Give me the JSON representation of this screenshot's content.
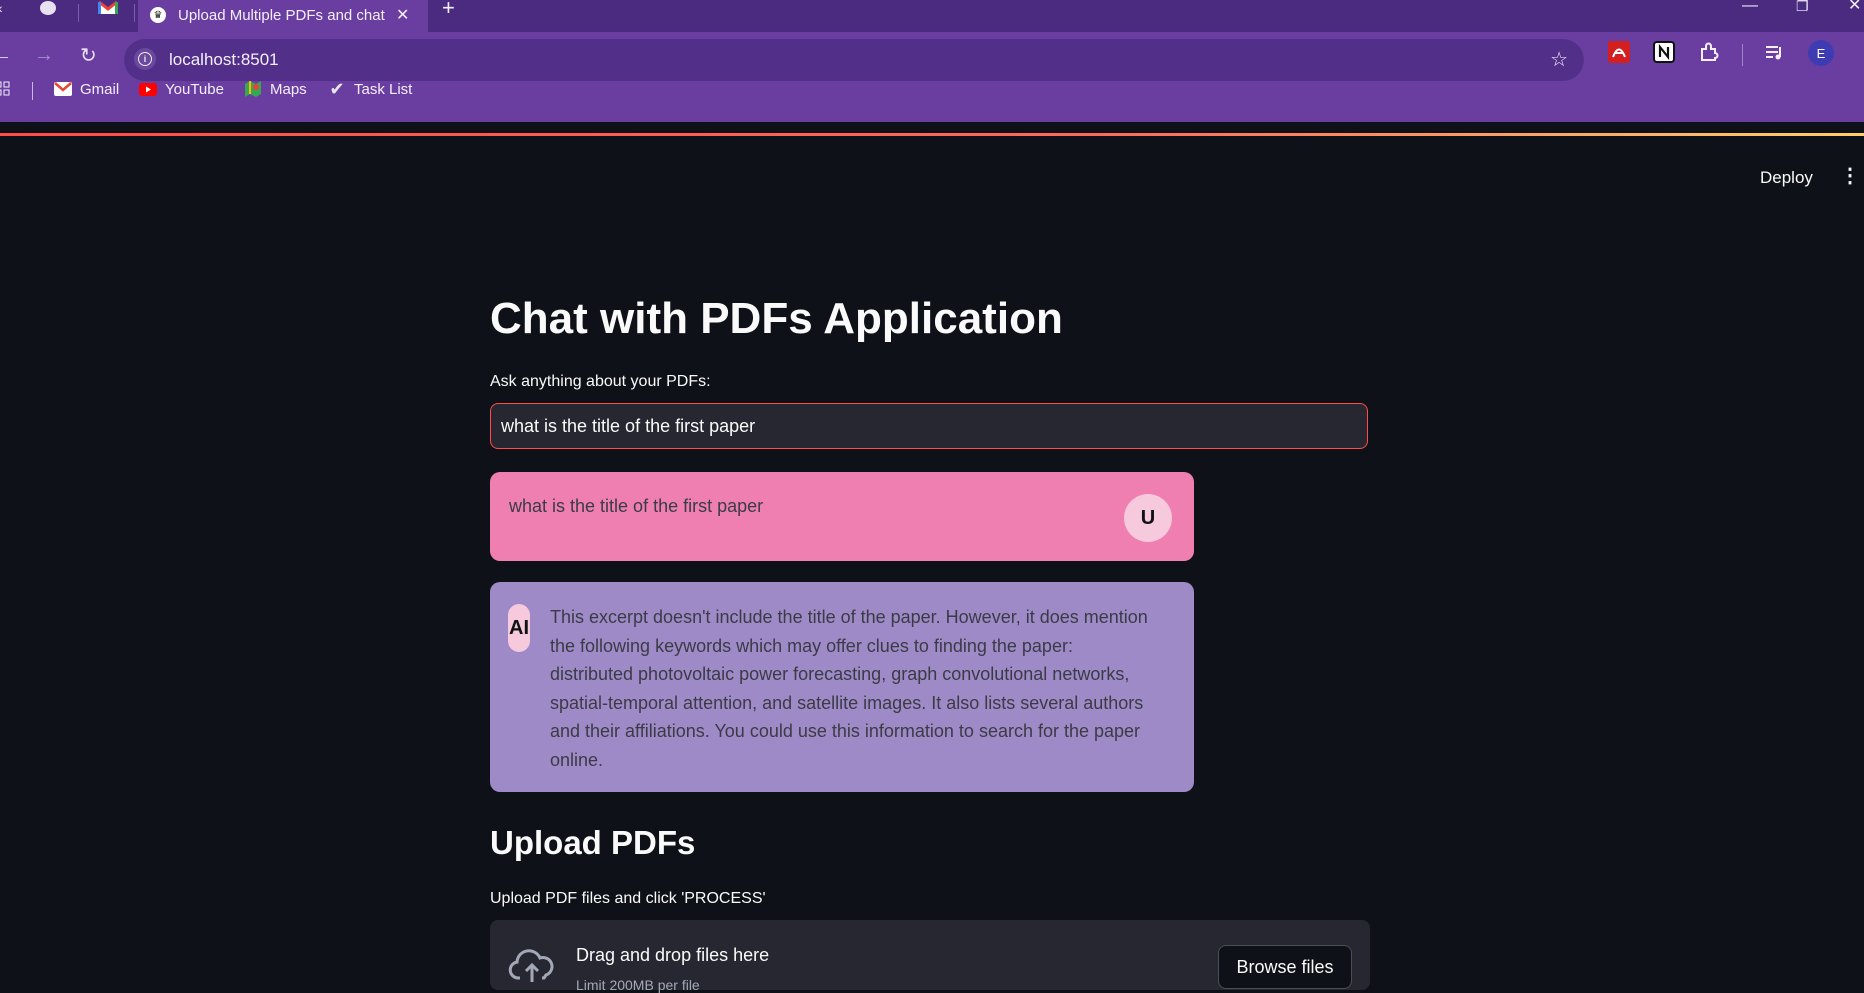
{
  "browser": {
    "active_tab_title": "Upload Multiple PDFs and chat",
    "new_tab_glyph": "+",
    "url": "localhost:8501",
    "profile_initial": "E",
    "bookmarks": [
      {
        "label": "Gmail",
        "icon": "gmail-icon"
      },
      {
        "label": "YouTube",
        "icon": "youtube-icon"
      },
      {
        "label": "Maps",
        "icon": "maps-icon"
      },
      {
        "label": "Task List",
        "icon": "checkmark-icon"
      }
    ]
  },
  "app": {
    "deploy_label": "Deploy",
    "title": "Chat with PDFs Application",
    "question_label": "Ask anything about your PDFs:",
    "question_value": "what is the title of the first paper",
    "messages": [
      {
        "role": "user",
        "avatar": "U",
        "text": "what is the title of the first paper"
      },
      {
        "role": "ai",
        "avatar": "AI",
        "text": "This excerpt doesn't include the title of the paper. However, it does mention the following keywords which may offer clues to finding the paper: distributed photovoltaic power forecasting, graph convolutional networks, spatial-temporal attention, and satellite images. It also lists several authors and their affiliations. You could use this information to search for the paper online."
      }
    ],
    "upload_heading": "Upload PDFs",
    "upload_caption": "Upload PDF files and click 'PROCESS'",
    "dropzone_title": "Drag and drop files here",
    "dropzone_limit": "Limit 200MB per file",
    "browse_label": "Browse files"
  },
  "colors": {
    "user_bubble": "#ef7fb1",
    "ai_bubble": "#9e8ac7",
    "accent": "#ff4b4b",
    "app_background": "#0e1117",
    "browser_frame": "#6a3ea1"
  }
}
